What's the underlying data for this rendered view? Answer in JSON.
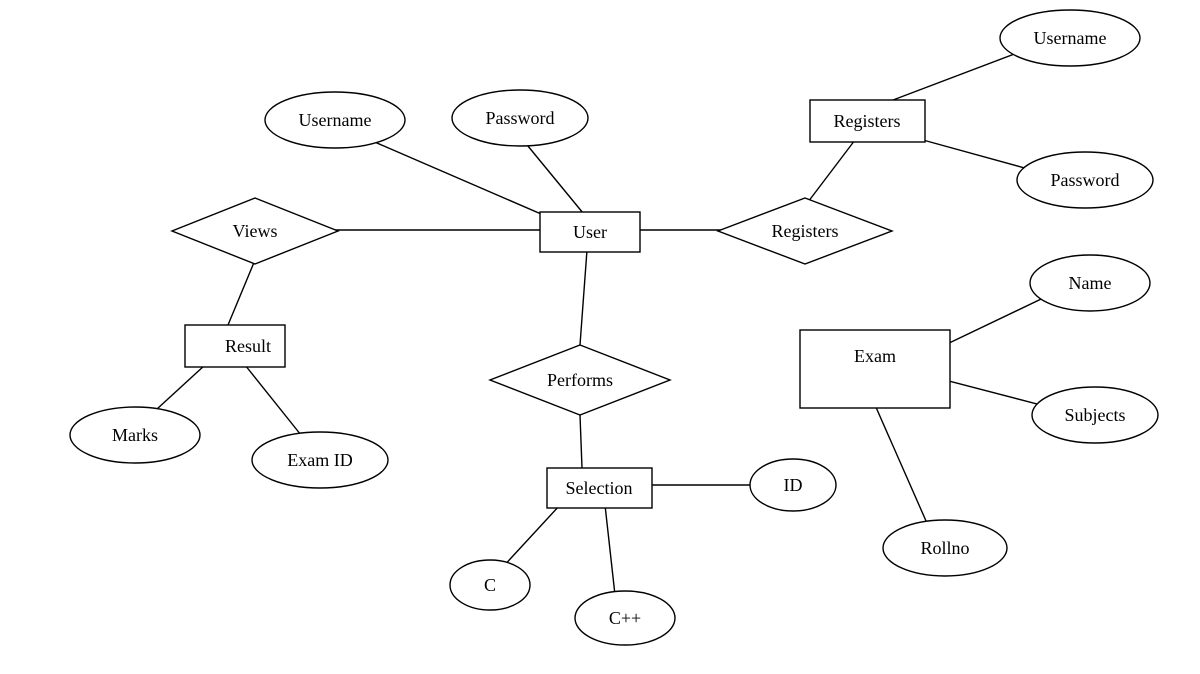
{
  "entities": {
    "user": "User",
    "registers_entity": "Registers",
    "result": "Result",
    "selection": "Selection",
    "exam": "Exam"
  },
  "relationships": {
    "views": "Views",
    "registers_rel": "Registers",
    "performs": "Performs"
  },
  "attributes": {
    "user_username": "Username",
    "user_password": "Password",
    "reg_username": "Username",
    "reg_password": "Password",
    "result_marks": "Marks",
    "result_examid": "Exam ID",
    "selection_id": "ID",
    "selection_c": "C",
    "selection_cpp": "C++",
    "exam_name": "Name",
    "exam_subjects": "Subjects",
    "exam_rollno": "Rollno"
  }
}
